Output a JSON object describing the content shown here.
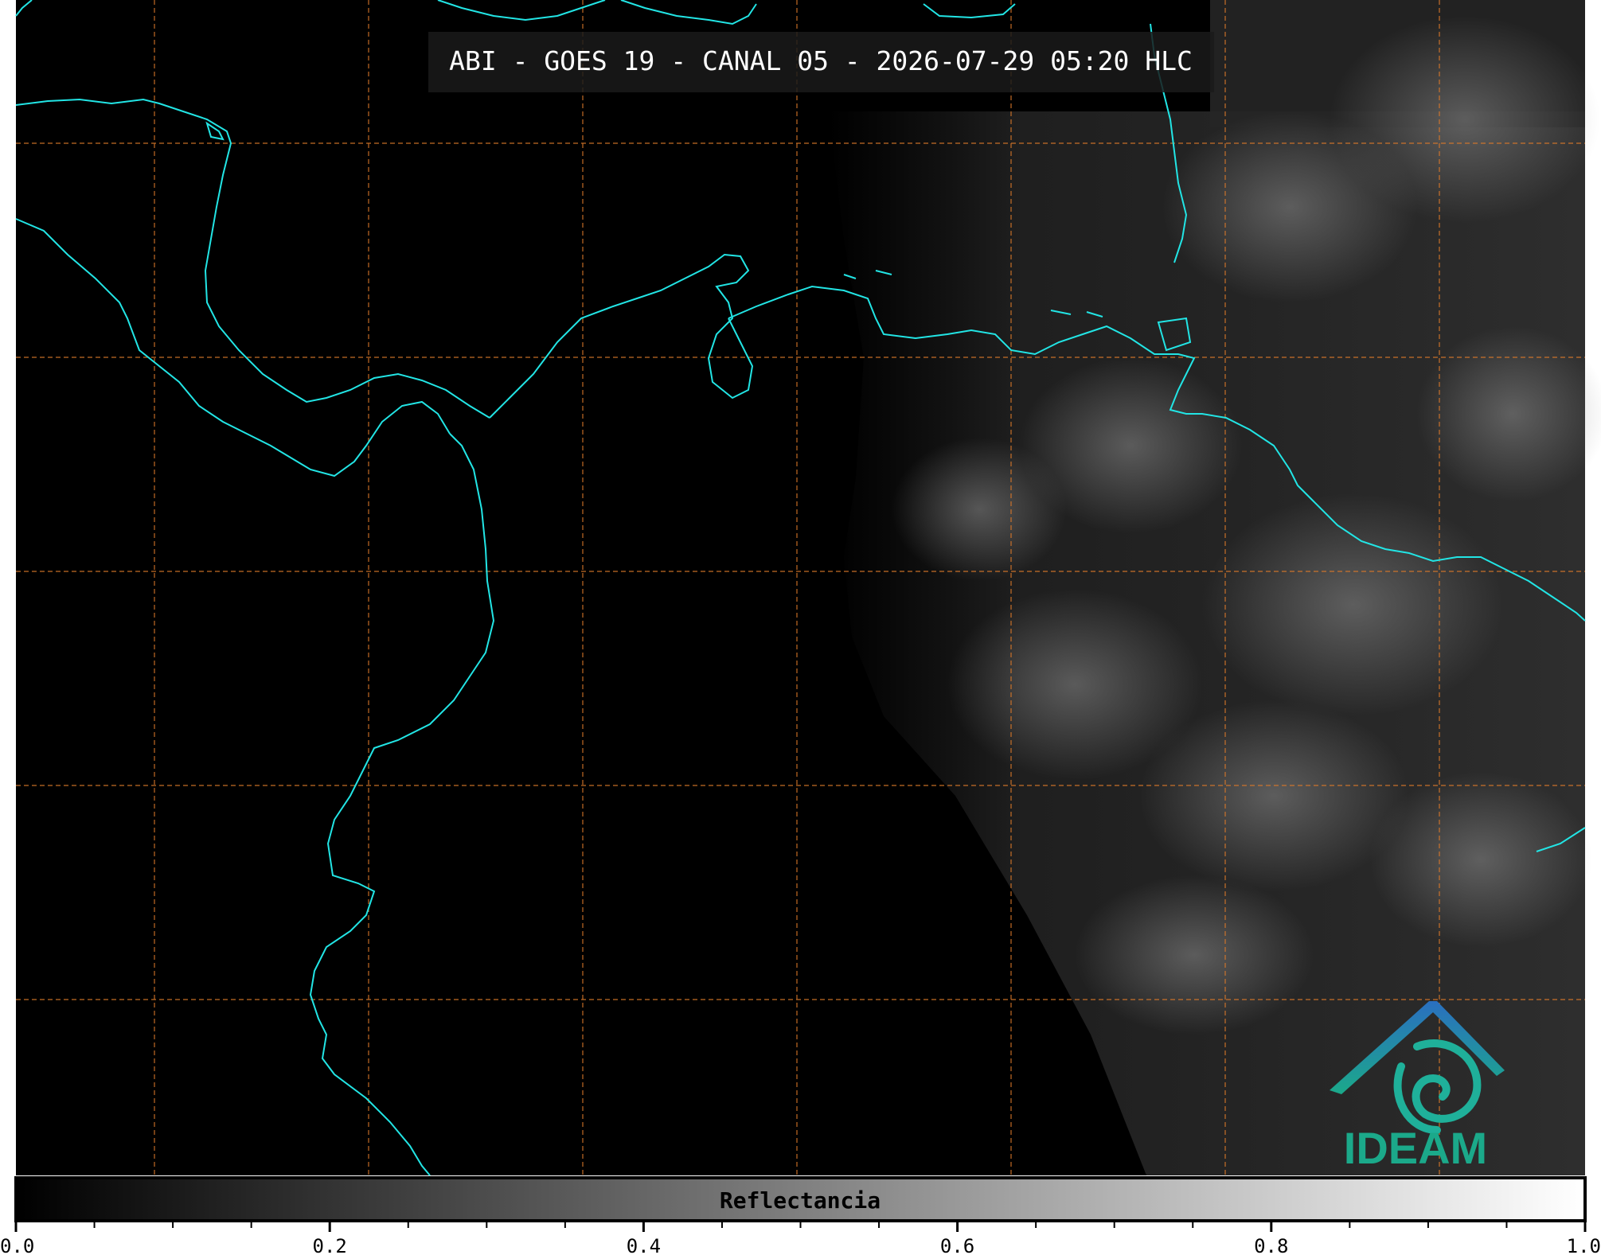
{
  "title": "ABI - GOES 19 - CANAL 05 - 2026-07-29 05:20 HLC",
  "colorbar": {
    "label": "Reflectancia",
    "ticks": [
      "0.0",
      "0.2",
      "0.4",
      "0.6",
      "0.8",
      "1.0"
    ],
    "range": [
      0.0,
      1.0
    ]
  },
  "logo": {
    "text": "IDEAM"
  },
  "colors": {
    "background": "#000000",
    "coastline": "#22e5e5",
    "gridlines": "#d9782a",
    "logo_blue": "#2a6fc0",
    "logo_teal": "#1ba98a"
  }
}
